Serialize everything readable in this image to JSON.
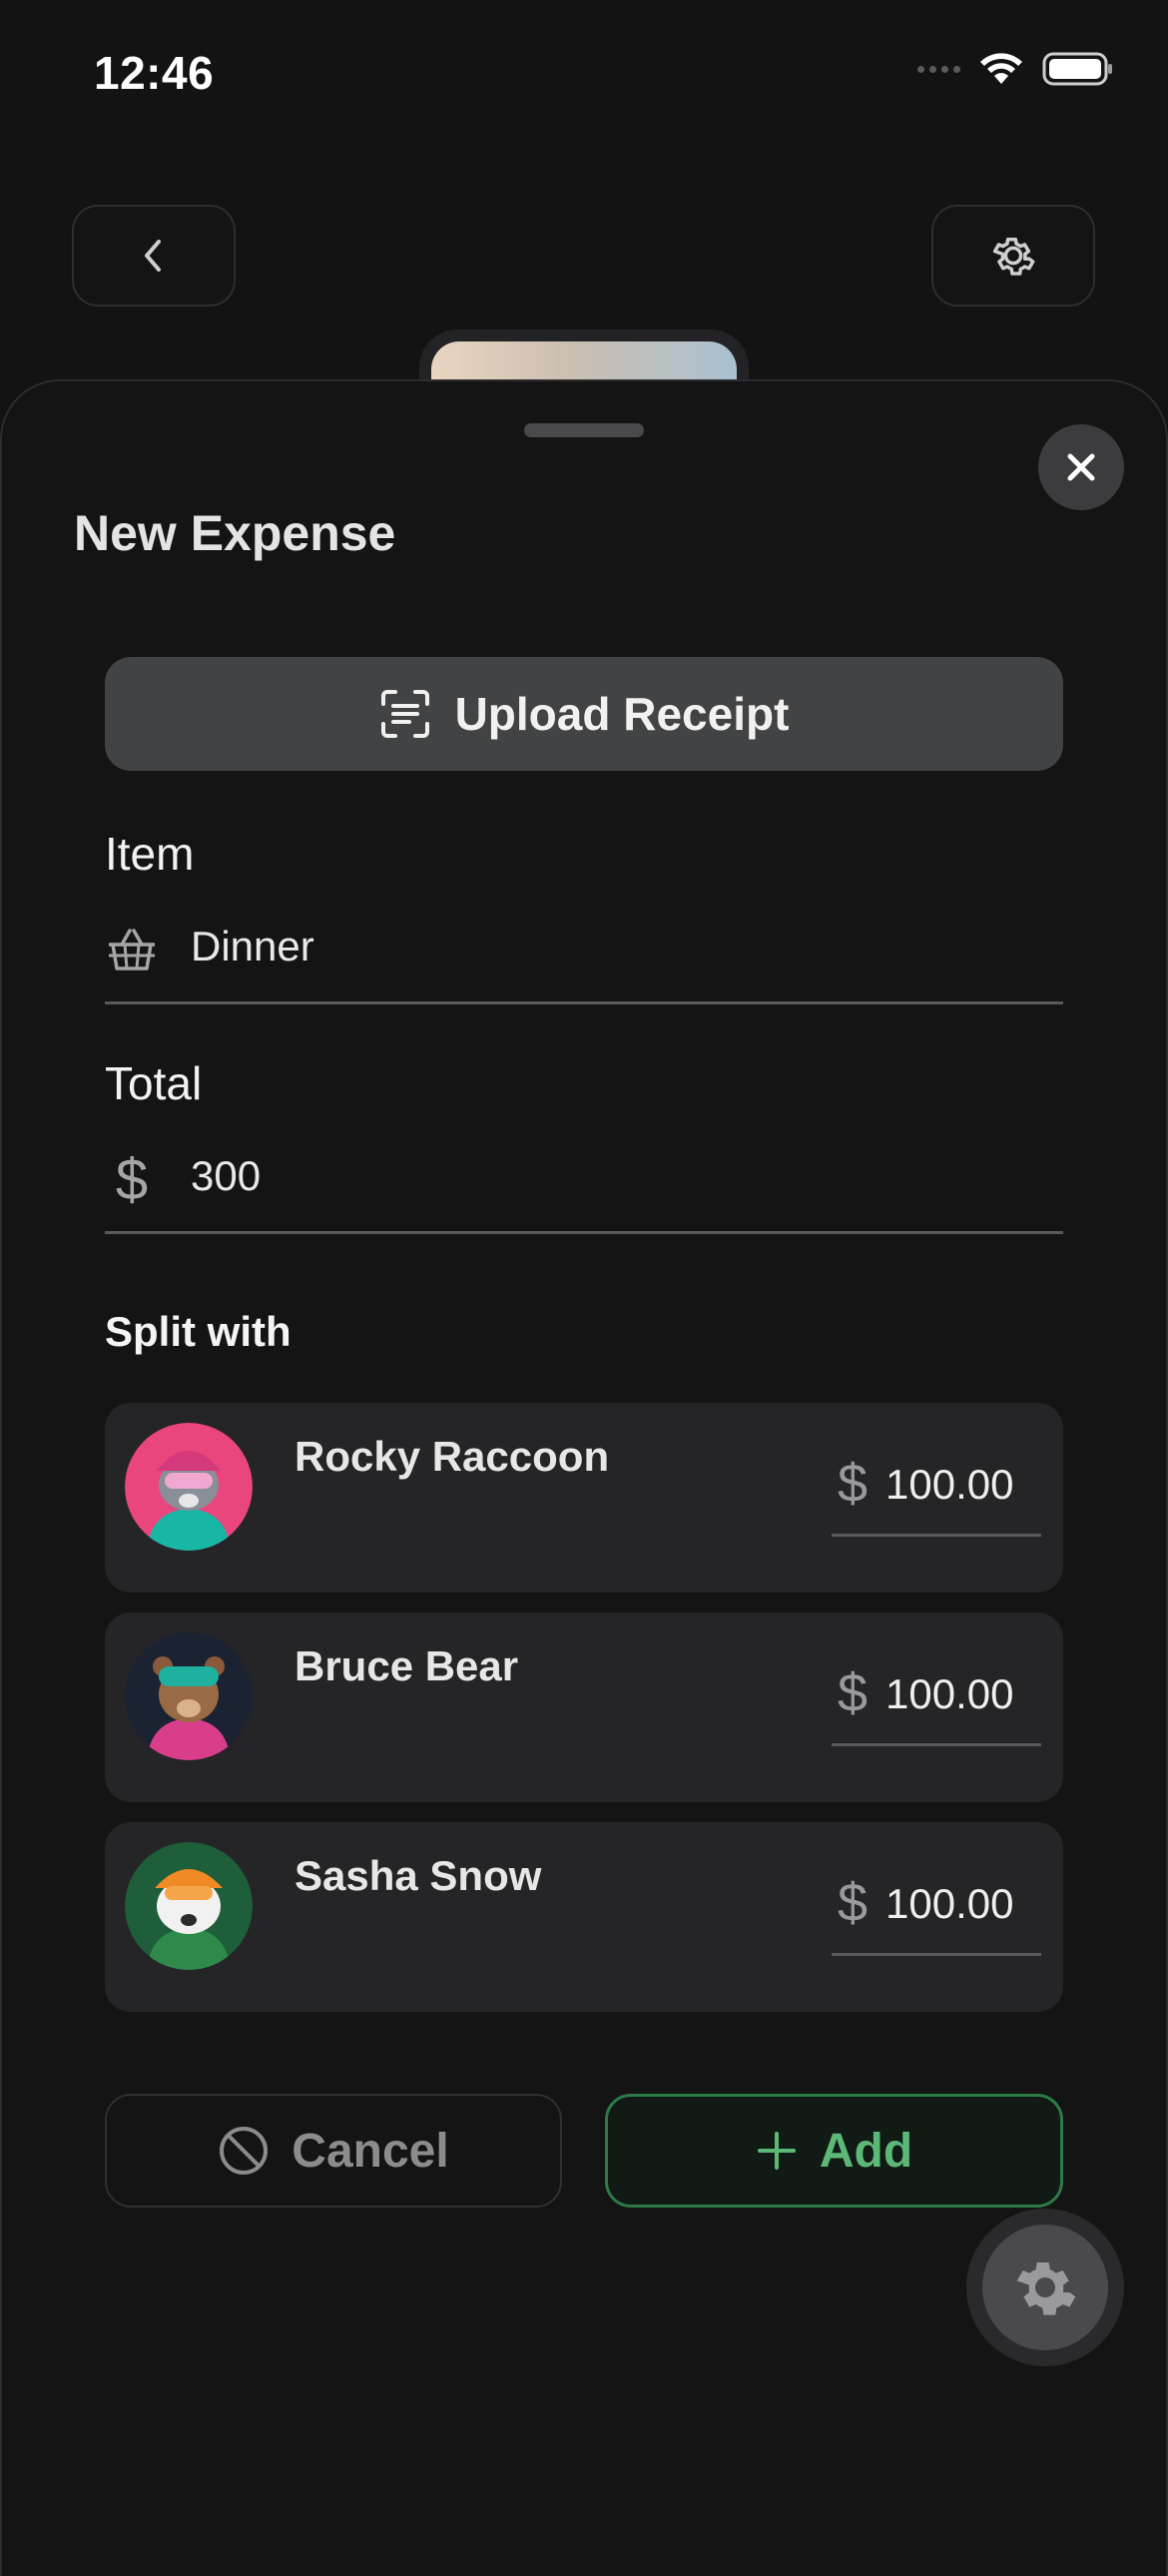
{
  "status_bar": {
    "time": "12:46"
  },
  "sheet": {
    "title": "New Expense",
    "upload_label": "Upload Receipt",
    "item": {
      "label": "Item",
      "value": "Dinner",
      "icon": "basket-icon"
    },
    "total": {
      "label": "Total",
      "value": "300",
      "icon": "dollar-icon"
    },
    "split_label": "Split with",
    "people": [
      {
        "name": "Rocky Raccoon",
        "currency": "$",
        "amount": "100.00",
        "avatar_color": "#e8467c"
      },
      {
        "name": "Bruce Bear",
        "currency": "$",
        "amount": "100.00",
        "avatar_color": "#1b2232"
      },
      {
        "name": "Sasha Snow",
        "currency": "$",
        "amount": "100.00",
        "avatar_color": "#1f5e3a"
      }
    ],
    "cancel_label": "Cancel",
    "add_label": "Add",
    "accent_color": "#5cb877"
  }
}
